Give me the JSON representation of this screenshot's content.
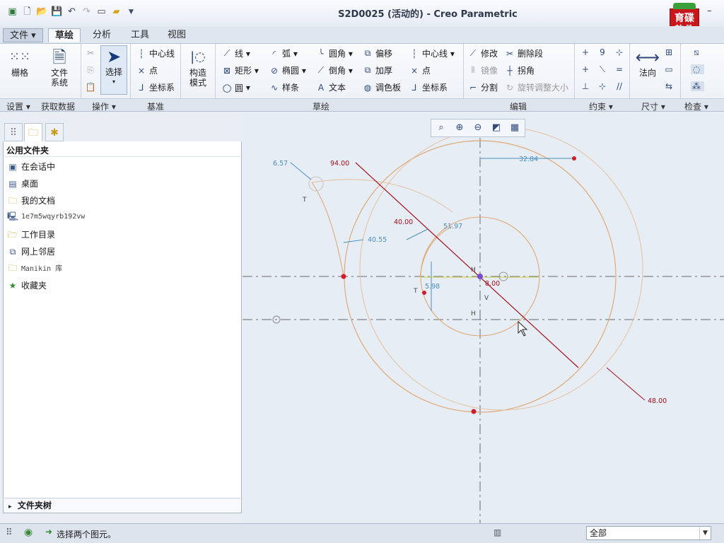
{
  "window": {
    "title": "S2D0025 (活动的) - Creo Parametric",
    "minimize": "–",
    "close": "✕"
  },
  "quick_access": [
    "new-icon",
    "open-icon",
    "save-icon",
    "undo-icon",
    "redo-icon",
    "window-icon",
    "folder-icon",
    "customize-icon"
  ],
  "logo": {
    "line1": "育碟",
    "line2": "软件"
  },
  "menu": {
    "file": "文件",
    "tabs": [
      "草绘",
      "分析",
      "工具",
      "视图"
    ],
    "active_tab": "草绘"
  },
  "ribbon": {
    "setup": {
      "grid": "栅格",
      "label": "设置"
    },
    "get_data": {
      "file_system_1": "文件",
      "file_system_2": "系统",
      "label": "获取数据"
    },
    "operations": {
      "select": "选择",
      "label": "操作"
    },
    "datum": {
      "centerline": "中心线",
      "point": "点",
      "csys": "坐标系",
      "label": "基准"
    },
    "construction": {
      "l1": "构造",
      "l2": "模式"
    },
    "sketch": {
      "line": "线",
      "arc": "弧",
      "fillet": "圆角",
      "offset": "偏移",
      "centerline": "中心线",
      "rectangle": "矩形",
      "ellipse": "椭圆",
      "chamfer": "倒角",
      "thicken": "加厚",
      "point": "点",
      "circle": "圆",
      "spline": "样条",
      "text": "文本",
      "palette": "调色板",
      "csys": "坐标系",
      "label": "草绘"
    },
    "editing": {
      "modify": "修改",
      "delete_segment": "删除段",
      "mirror": "镜像",
      "corner": "拐角",
      "divide": "分割",
      "rotate_resize": "旋转调整大小",
      "label": "编辑"
    },
    "constrain": {
      "label": "约束"
    },
    "dimension": {
      "normal": "法向",
      "label": "尺寸"
    },
    "inspect": {
      "label": "检查"
    }
  },
  "sidebar": {
    "header": "公用文件夹",
    "items": [
      {
        "icon": "session-icon",
        "label": "在会话中"
      },
      {
        "icon": "desktop-icon",
        "label": "桌面"
      },
      {
        "icon": "documents-icon",
        "label": "我的文档"
      },
      {
        "icon": "computer-icon",
        "label": "1e7m5wqyrb192vw"
      },
      {
        "icon": "workdir-icon",
        "label": "工作目录"
      },
      {
        "icon": "network-icon",
        "label": "网上邻居"
      },
      {
        "icon": "library-icon",
        "label": "Manikin 库"
      },
      {
        "icon": "favorites-icon",
        "label": "收藏夹"
      }
    ],
    "folder_tree": "文件夹树"
  },
  "sketch_dims": {
    "d1": "94.00",
    "d2": "32.84",
    "d3": "40.00",
    "d4": "40.55",
    "d5": "6.57",
    "d6": "51.97",
    "d7": "5.98",
    "d8": "8.00",
    "d9": "48.00"
  },
  "sketch_marks": {
    "t1": "T",
    "t2": "T",
    "h1": "H",
    "h2": "H",
    "v1": "V"
  },
  "status": {
    "message": "选择两个图元。",
    "filter": "全部"
  },
  "colors": {
    "dim_red": "#a3101a",
    "dim_blue": "#4a8fc0",
    "geometry": "#e0a979",
    "centerline": "#6a6a6a"
  }
}
